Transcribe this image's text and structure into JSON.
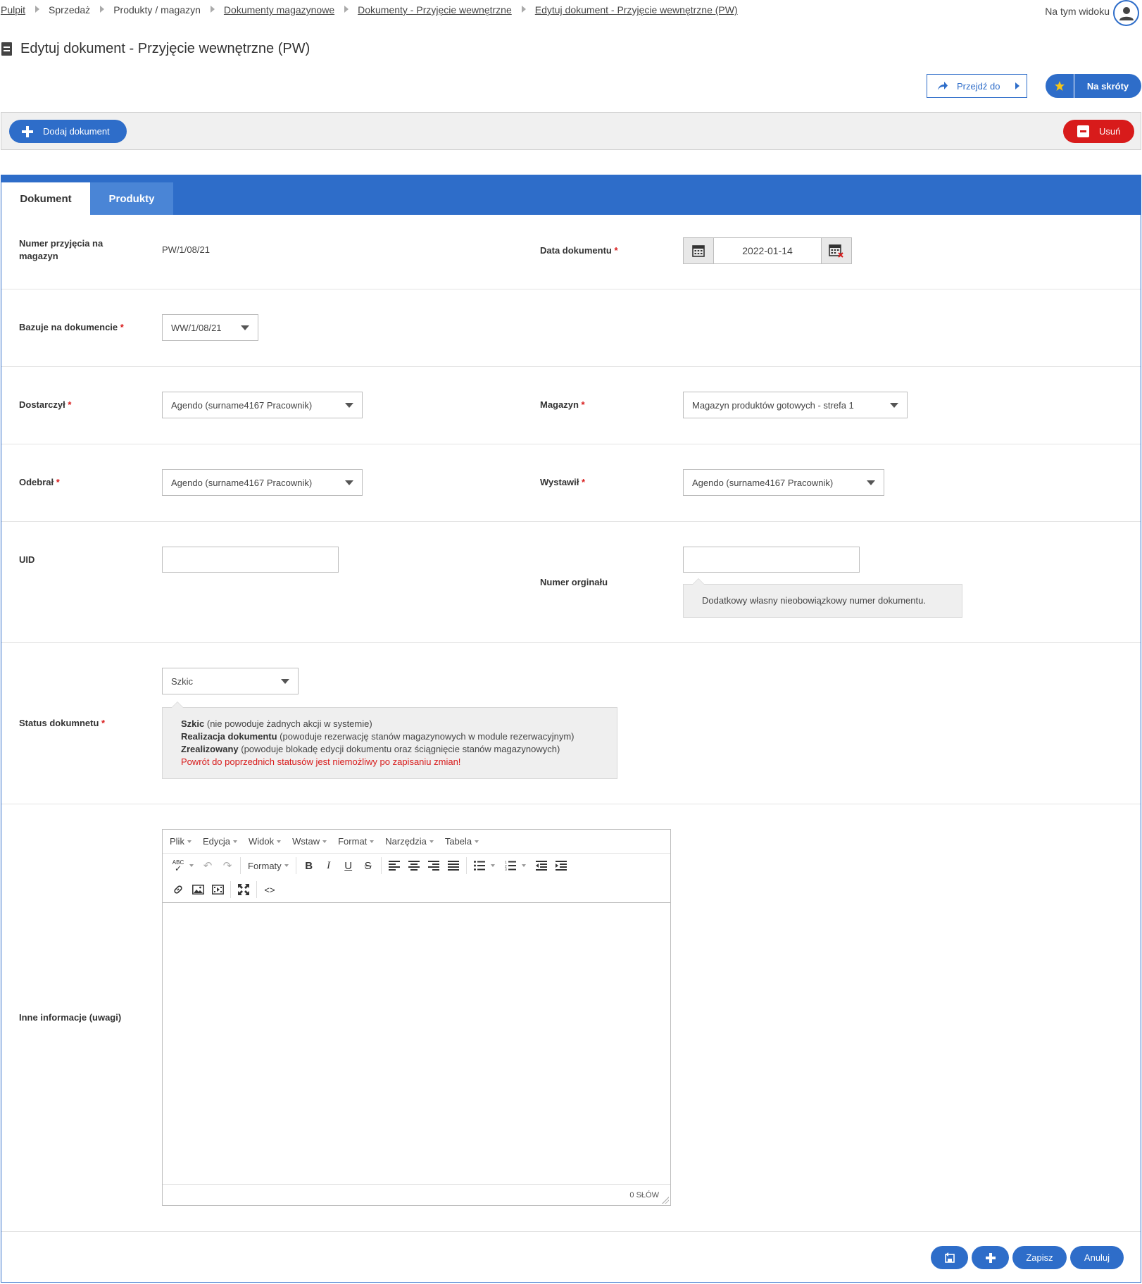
{
  "breadcrumb": {
    "items": [
      "Pulpit",
      "Sprzedaż",
      "Produkty / magazyn",
      "Dokumenty magazynowe",
      "Dokumenty - Przyjęcie wewnętrzne",
      "Edytuj dokument - Przyjęcie wewnętrzne (PW)"
    ]
  },
  "header": {
    "view_label": "Na tym widoku",
    "page_title": "Edytuj dokument - Przyjęcie wewnętrzne (PW)",
    "goto_label": "Przejdź do",
    "shortcuts_label": "Na skróty"
  },
  "toolbar": {
    "add_label": "Dodaj dokument",
    "delete_label": "Usuń"
  },
  "tabs": [
    "Dokument",
    "Produkty"
  ],
  "form": {
    "numer_label": "Numer przyjęcia na magazyn",
    "numer_value": "PW/1/08/21",
    "data_label": "Data dokumentu",
    "data_value": "2022-01-14",
    "bazuje_label": "Bazuje na dokumencie",
    "bazuje_value": "WW/1/08/21",
    "dostarczyl_label": "Dostarczył",
    "dostarczyl_value": "Agendo (surname4167 Pracownik)",
    "magazyn_label": "Magazyn",
    "magazyn_value": "Magazyn produktów gotowych - strefa 1",
    "odebral_label": "Odebrał",
    "odebral_value": "Agendo (surname4167 Pracownik)",
    "wystawil_label": "Wystawił",
    "wystawil_value": "Agendo (surname4167 Pracownik)",
    "uid_label": "UID",
    "uid_value": "",
    "numer_org_label": "Numer orginału",
    "numer_org_value": "",
    "numer_org_hint": "Dodatkowy własny nieobowiązkowy numer dokumentu.",
    "status_label": "Status dokumnetu",
    "status_value": "Szkic",
    "status_hint": {
      "l1_bold": "Szkic",
      "l1_rest": " (nie powoduje żadnych akcji w systemie)",
      "l2_bold": "Realizacja dokumentu",
      "l2_rest": " (powoduje rezerwację stanów magazynowych w module rezerwacyjnym)",
      "l3_bold": "Zrealizowany",
      "l3_rest": " (powoduje blokadę edycji dokumentu oraz ściągnięcie stanów magazynowych)",
      "warning": "Powrót do poprzednich statusów jest niemożliwy po zapisaniu zmian!"
    },
    "uwagi_label": "Inne informacje (uwagi)",
    "required_mark": "*"
  },
  "editor": {
    "menu": [
      "Plik",
      "Edycja",
      "Widok",
      "Wstaw",
      "Format",
      "Narzędzia",
      "Tabela"
    ],
    "formats_label": "Formaty",
    "word_count": "0 SŁÓW",
    "spellcheck_text": "ABC"
  },
  "footer": {
    "save_label": "Zapisz",
    "cancel_label": "Anuluj"
  },
  "colors": {
    "primary": "#2e6dc9",
    "danger": "#d81b1b",
    "star": "#f5c518"
  }
}
